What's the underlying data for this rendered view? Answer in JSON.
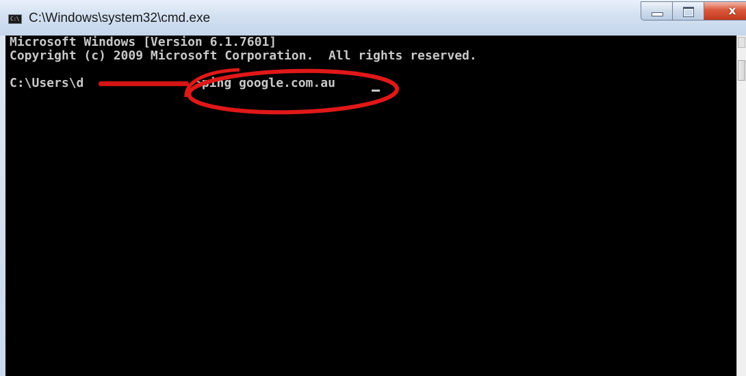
{
  "window": {
    "title": "C:\\Windows\\system32\\cmd.exe",
    "app_icon_text": "C:\\",
    "controls": {
      "minimize_icon": "minimize-icon",
      "maximize_icon": "maximize-icon",
      "close_icon": "close-icon",
      "close_glyph": "x"
    }
  },
  "console": {
    "lines": [
      "Microsoft Windows [Version 6.1.7601]",
      "Copyright (c) 2009 Microsoft Corporation.  All rights reserved."
    ],
    "prompt_prefix": "C:\\Users\\d",
    "prompt_suffix": ">ping google.com.au",
    "text_color": "#c8c8c8",
    "background_color": "#000000"
  },
  "annotations": {
    "redaction_color": "#d51414",
    "highlight_circle_color": "#e01818"
  }
}
